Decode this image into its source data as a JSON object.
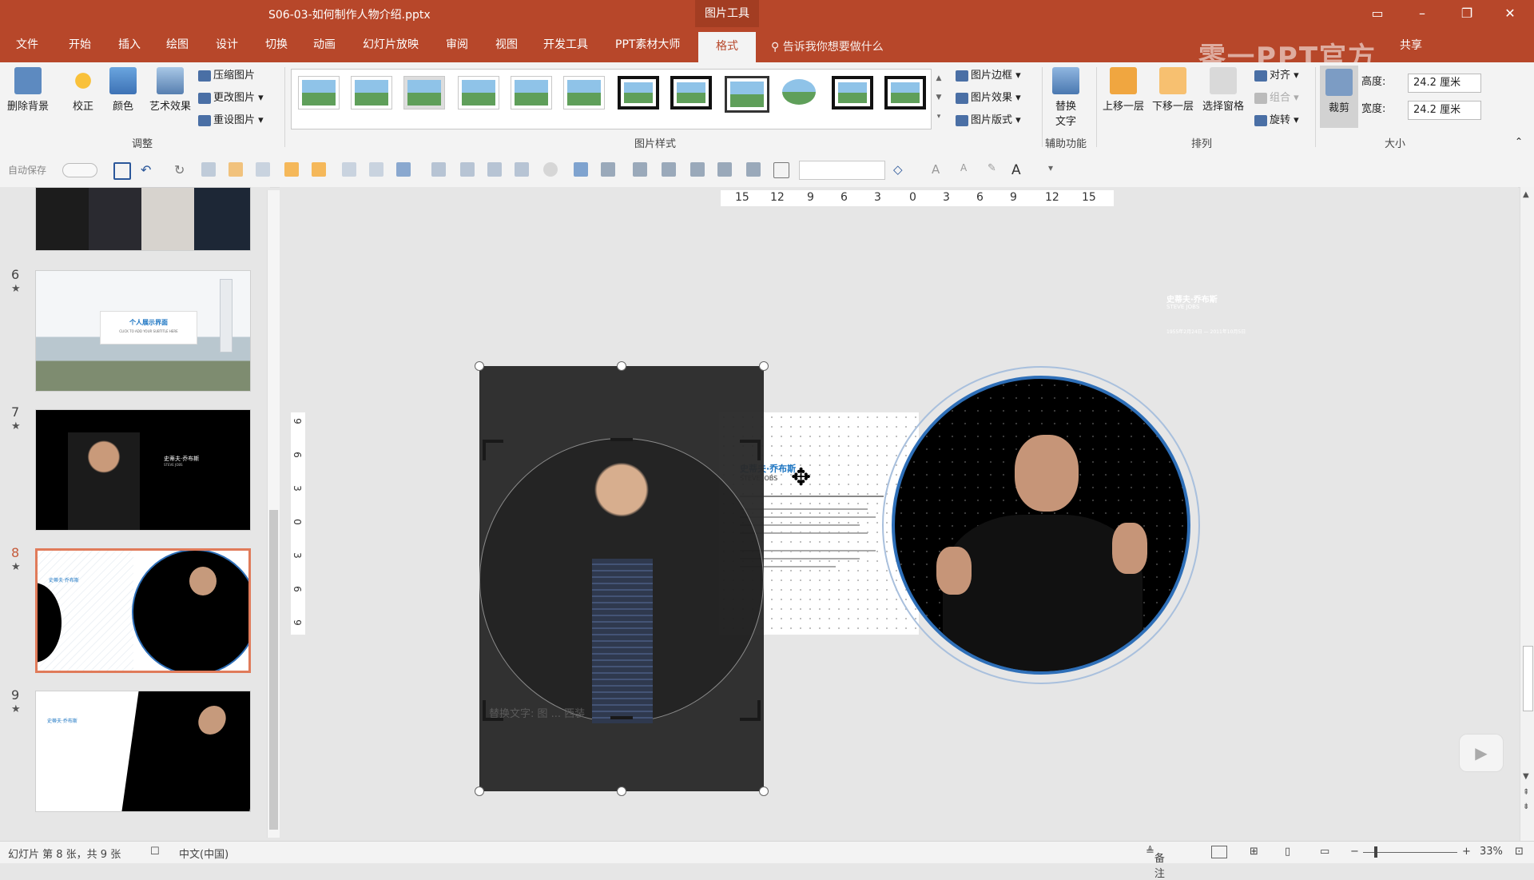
{
  "titlebar": {
    "doc_title": "S06-03-如何制作人物介绍.pptx",
    "context_tab": "图片工具",
    "watermark": "零一PPT官方",
    "share": "共享"
  },
  "menu": {
    "tabs": [
      "文件",
      "开始",
      "插入",
      "绘图",
      "设计",
      "切换",
      "动画",
      "幻灯片放映",
      "审阅",
      "视图",
      "开发工具",
      "PPT素材大师",
      "格式"
    ],
    "active_tab": "格式",
    "tell_me": "告诉我你想要做什么"
  },
  "ribbon": {
    "adjust": {
      "remove_bg": "删除背景",
      "correct": "校正",
      "color": "颜色",
      "art_effects": "艺术效果",
      "compress": "压缩图片",
      "change": "更改图片",
      "reset": "重设图片",
      "label": "调整"
    },
    "styles": {
      "border": "图片边框",
      "effects": "图片效果",
      "layout": "图片版式",
      "label": "图片样式"
    },
    "accessibility": {
      "alt_text_line1": "替换",
      "alt_text_line2": "文字",
      "label": "辅助功能"
    },
    "arrange": {
      "bring_forward": "上移一层",
      "send_backward": "下移一层",
      "selection_pane": "选择窗格",
      "align": "对齐",
      "group": "组合",
      "rotate": "旋转",
      "label": "排列"
    },
    "size": {
      "crop": "裁剪",
      "height_label": "高度:",
      "height_value": "24.2 厘米",
      "width_label": "宽度:",
      "width_value": "24.2 厘米",
      "label": "大小"
    }
  },
  "qat": {
    "autosave": "自动保存",
    "toggle_state": "关"
  },
  "thumbnails": [
    {
      "num": "6",
      "star": "★"
    },
    {
      "num": "7",
      "star": "★"
    },
    {
      "num": "8",
      "star": "★"
    },
    {
      "num": "9",
      "star": "★"
    }
  ],
  "thumb_text": {
    "s6_title": "个人展示界面",
    "s6_sub": "CLICK TO ADD YOUR SUBTITLE HERE",
    "s7_title": "史蒂夫·乔布斯",
    "s7_sub": "STEVE JOBS",
    "s8_title": "史蒂夫·乔布斯",
    "s9_title": "史蒂夫·乔布斯"
  },
  "ruler": {
    "h": [
      "15",
      "12",
      "9",
      "6",
      "3",
      "0",
      "3",
      "6",
      "9",
      "12",
      "15"
    ],
    "v": [
      "9",
      "6",
      "3",
      "0",
      "3",
      "6",
      "9"
    ]
  },
  "slide": {
    "title": "史蒂夫·乔布斯",
    "subtitle": "STEVE JOBS",
    "alt_text_overlay": "替换文字: 图 ... 西装",
    "top_right_title": "史蒂夫·乔布斯",
    "top_right_sub": "STEVE JOBS",
    "date_line": "1955年2月24日 — 2011年10月5日"
  },
  "status": {
    "slide_info": "幻灯片 第 8 张，共 9 张",
    "language": "中文(中国)",
    "notes": "备注",
    "zoom": "33%"
  },
  "colors": {
    "accent": "#b7472a",
    "selection": "#c55a3a",
    "ring": "#2e6fb8"
  }
}
